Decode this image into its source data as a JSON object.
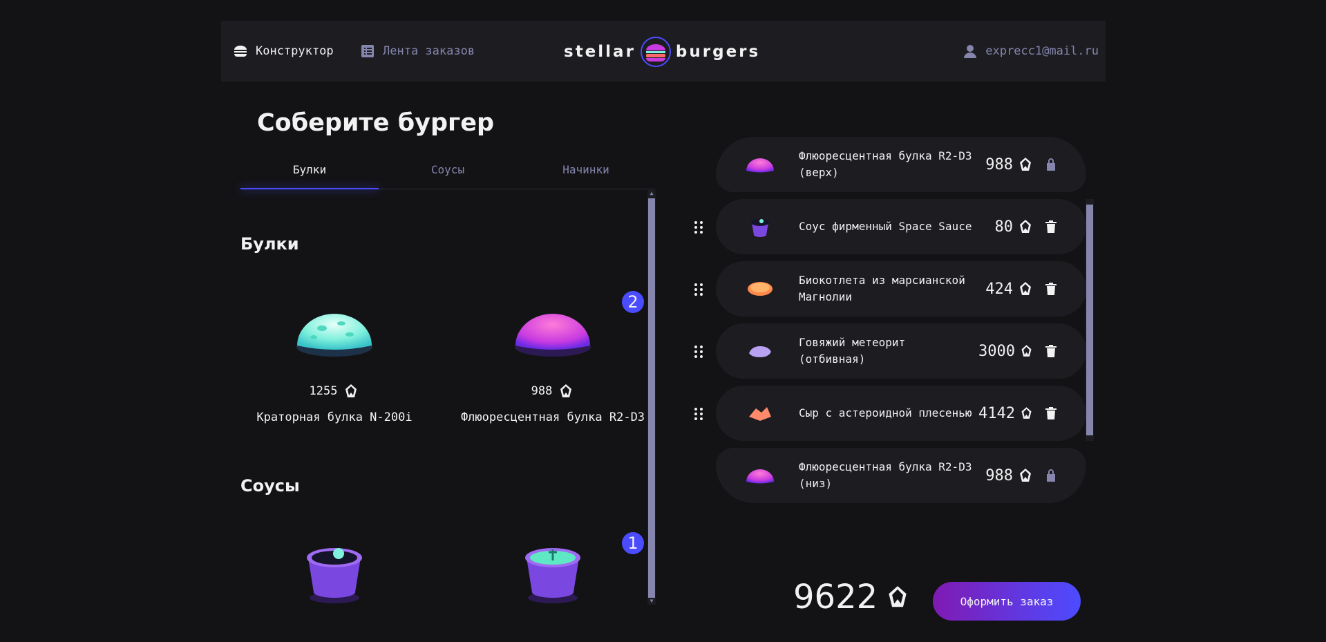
{
  "header": {
    "constructor_label": "Конструктор",
    "feed_label": "Лента заказов",
    "profile_label": "exprecc1@mail.ru",
    "logo_left": "stellar",
    "logo_right": "burgers"
  },
  "main": {
    "title": "Соберите бургер",
    "tabs": [
      {
        "label": "Булки",
        "active": true
      },
      {
        "label": "Соусы",
        "active": false
      },
      {
        "label": "Начинки",
        "active": false
      }
    ],
    "sections": {
      "buns": {
        "title": "Булки",
        "items": [
          {
            "price": "1255",
            "name": "Краторная булка N-200i"
          },
          {
            "price": "988",
            "name": "Флюоресцентная булка R2-D3",
            "count": "2"
          }
        ]
      },
      "sauces": {
        "title": "Соусы",
        "items": [
          {
            "count": "1"
          }
        ]
      }
    }
  },
  "constructor": {
    "top_bun": {
      "name": "Флюоресцентная булка R2-D3 (верх)",
      "price": "988"
    },
    "fillings": [
      {
        "name": "Соус фирменный Space Sauce",
        "price": "80"
      },
      {
        "name": "Биокотлета из марсианской Магнолии",
        "price": "424"
      },
      {
        "name": "Говяжий метеорит (отбивная)",
        "price": "3000"
      },
      {
        "name": "Сыр с астероидной плесенью",
        "price": "4142"
      }
    ],
    "bottom_bun": {
      "name": "Флюоресцентная булка R2-D3 (низ)",
      "price": "988"
    },
    "total": "9622",
    "order_label": "Оформить заказ"
  },
  "colors": {
    "background": "#131316",
    "panel": "#1C1C21",
    "accent": "#4C4CFF",
    "inactive": "#8585AD",
    "button_gradient_start": "#801AB3"
  }
}
